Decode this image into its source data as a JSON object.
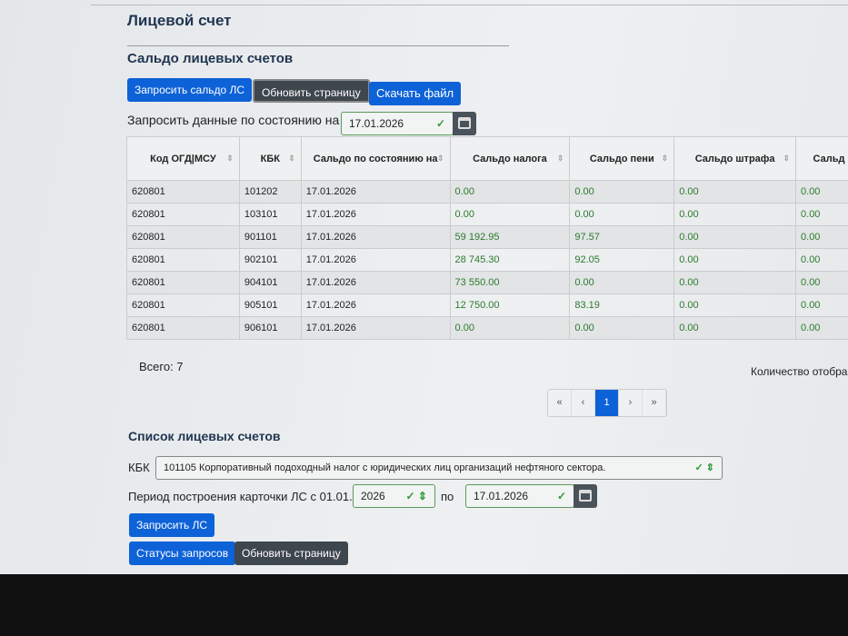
{
  "page_title": "Лицевой счет",
  "balance_section": {
    "title": "Сальдо лицевых счетов",
    "request_button": "Запросить сальдо ЛС",
    "refresh_button": "Обновить страницу",
    "download_button": "Скачать файл",
    "date_label": "Запросить данные по состоянию на",
    "date_value": "17.01.2026",
    "columns": [
      "Код ОГД|МСУ",
      "КБК",
      "Сальдо по состоянию на",
      "Сальдо налога",
      "Сальдо пени",
      "Сальдо штрафа",
      "Сальд"
    ],
    "rows": [
      [
        "620801",
        "101202",
        "17.01.2026",
        "0.00",
        "0.00",
        "0.00",
        "0.00"
      ],
      [
        "620801",
        "103101",
        "17.01.2026",
        "0.00",
        "0.00",
        "0.00",
        "0.00"
      ],
      [
        "620801",
        "901101",
        "17.01.2026",
        "59 192.95",
        "97.57",
        "0.00",
        "0.00"
      ],
      [
        "620801",
        "902101",
        "17.01.2026",
        "28 745.30",
        "92.05",
        "0.00",
        "0.00"
      ],
      [
        "620801",
        "904101",
        "17.01.2026",
        "73 550.00",
        "0.00",
        "0.00",
        "0.00"
      ],
      [
        "620801",
        "905101",
        "17.01.2026",
        "12 750.00",
        "83.19",
        "0.00",
        "0.00"
      ],
      [
        "620801",
        "906101",
        "17.01.2026",
        "0.00",
        "0.00",
        "0.00",
        "0.00"
      ]
    ],
    "total": "Всего: 7",
    "page_size_label": "Количество отобра",
    "pagination": [
      "«",
      "‹",
      "1",
      "›",
      "»"
    ]
  },
  "accounts_section": {
    "title": "Список лицевых счетов",
    "kbk_label": "КБК",
    "kbk_value": "101105 Корпоративный подоходный налог с юридических лиц организаций нефтяного сектора.",
    "period_label": "Период построения карточки ЛС с 01.01.",
    "year_value": "2026",
    "to_label": "по",
    "to_date": "17.01.2026",
    "request_button": "Запросить ЛС",
    "statuses_button": "Статусы запросов",
    "refresh_button": "Обновить страницу"
  }
}
